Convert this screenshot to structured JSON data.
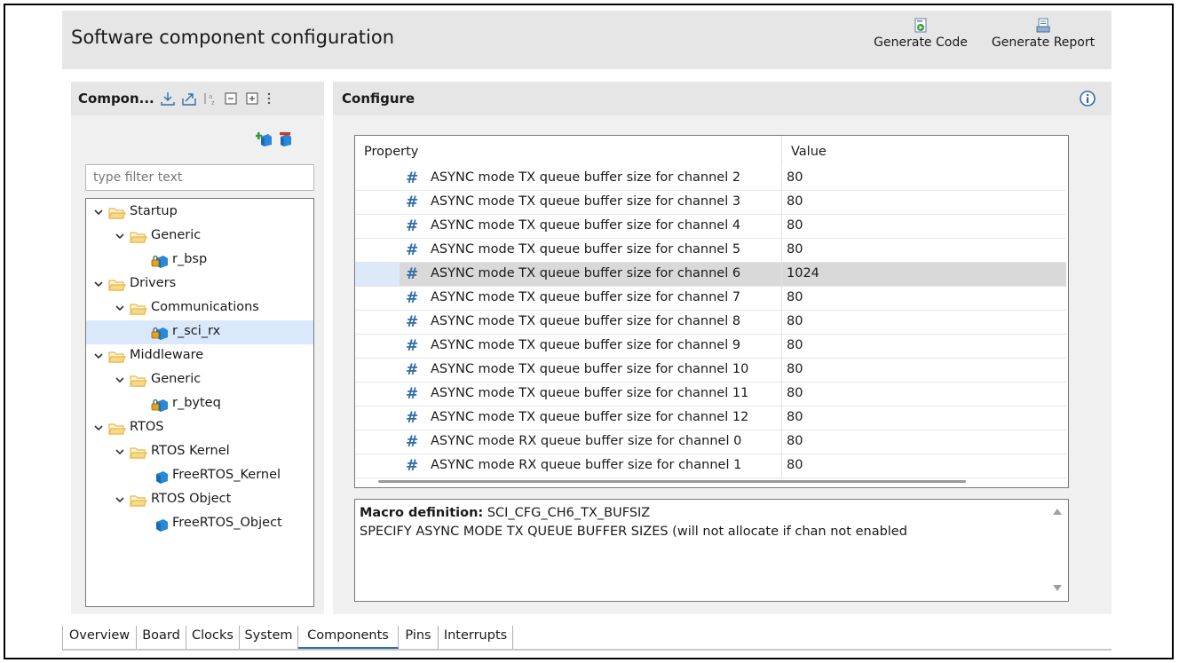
{
  "window": {
    "title": "Software component configuration"
  },
  "toolbar": {
    "generate_code_label": "Generate Code",
    "generate_report_label": "Generate Report"
  },
  "components_panel": {
    "title": "Compon...",
    "filter_placeholder": "type filter text",
    "tree": [
      {
        "label": "Startup",
        "depth": 0,
        "kind": "folder"
      },
      {
        "label": "Generic",
        "depth": 1,
        "kind": "folder"
      },
      {
        "label": "r_bsp",
        "depth": 2,
        "kind": "component-lock"
      },
      {
        "label": "Drivers",
        "depth": 0,
        "kind": "folder"
      },
      {
        "label": "Communications",
        "depth": 1,
        "kind": "folder"
      },
      {
        "label": "r_sci_rx",
        "depth": 2,
        "kind": "component-lock",
        "selected": true
      },
      {
        "label": "Middleware",
        "depth": 0,
        "kind": "folder"
      },
      {
        "label": "Generic",
        "depth": 1,
        "kind": "folder"
      },
      {
        "label": "r_byteq",
        "depth": 2,
        "kind": "component-lock"
      },
      {
        "label": "RTOS",
        "depth": 0,
        "kind": "folder"
      },
      {
        "label": "RTOS Kernel",
        "depth": 1,
        "kind": "folder"
      },
      {
        "label": "FreeRTOS_Kernel",
        "depth": 2,
        "kind": "component"
      },
      {
        "label": "RTOS Object",
        "depth": 1,
        "kind": "folder"
      },
      {
        "label": "FreeRTOS_Object",
        "depth": 2,
        "kind": "component"
      }
    ]
  },
  "configure_panel": {
    "title": "Configure",
    "columns": {
      "property": "Property",
      "value": "Value"
    },
    "rows": [
      {
        "property": "ASYNC mode TX queue buffer size for channel 2",
        "value": "80"
      },
      {
        "property": "ASYNC mode TX queue buffer size for channel 3",
        "value": "80"
      },
      {
        "property": "ASYNC mode TX queue buffer size for channel 4",
        "value": "80"
      },
      {
        "property": "ASYNC mode TX queue buffer size for channel 5",
        "value": "80"
      },
      {
        "property": "ASYNC mode TX queue buffer size for channel 6",
        "value": "1024",
        "selected": true
      },
      {
        "property": "ASYNC mode TX queue buffer size for channel 7",
        "value": "80"
      },
      {
        "property": "ASYNC mode TX queue buffer size for channel 8",
        "value": "80"
      },
      {
        "property": "ASYNC mode TX queue buffer size for channel 9",
        "value": "80"
      },
      {
        "property": "ASYNC mode TX queue buffer size for channel 10",
        "value": "80"
      },
      {
        "property": "ASYNC mode TX queue buffer size for channel 11",
        "value": "80"
      },
      {
        "property": "ASYNC mode TX queue buffer size for channel 12",
        "value": "80"
      },
      {
        "property": "ASYNC mode RX queue buffer size for channel 0",
        "value": "80"
      },
      {
        "property": "ASYNC mode RX queue buffer size for channel 1",
        "value": "80"
      }
    ],
    "description": {
      "macro_label": "Macro definition:",
      "macro_value": "SCI_CFG_CH6_TX_BUFSIZ",
      "text": "SPECIFY ASYNC MODE TX QUEUE BUFFER SIZES (will not allocate if chan not enabled"
    }
  },
  "tabs": [
    {
      "label": "Overview"
    },
    {
      "label": "Board"
    },
    {
      "label": "Clocks"
    },
    {
      "label": "System"
    },
    {
      "label": "Components",
      "active": true
    },
    {
      "label": "Pins"
    },
    {
      "label": "Interrupts"
    }
  ],
  "colors": {
    "accent": "#2f6ea8",
    "selection": "#d9e8fb",
    "folder": "#e8b84a",
    "component": "#2a88d8"
  }
}
